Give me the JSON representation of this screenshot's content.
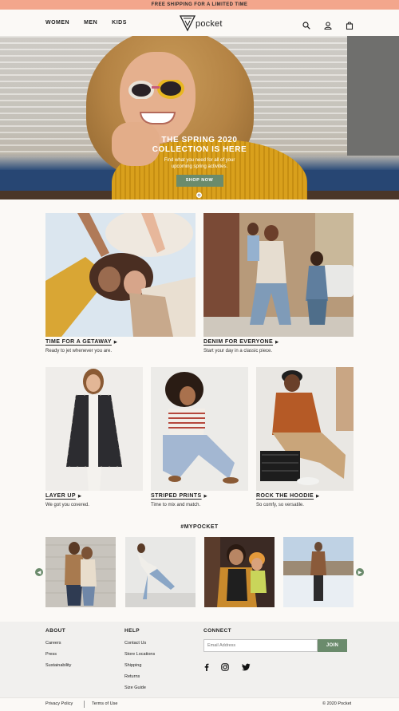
{
  "promo": {
    "text": "FREE SHIPPING FOR A LIMITED TIME"
  },
  "header": {
    "nav": [
      {
        "label": "WOMEN"
      },
      {
        "label": "MEN"
      },
      {
        "label": "KIDS"
      }
    ],
    "logo_text": "pocket",
    "icons": [
      "search-icon",
      "user-icon",
      "bag-icon"
    ]
  },
  "hero": {
    "title_line1": "THE SPRING 2020",
    "title_line2": "COLLECTION IS HERE",
    "subtitle_line1": "Find what you need for all of your",
    "subtitle_line2": "upcoming spring activities.",
    "button_label": "SHOP NOW"
  },
  "features": [
    {
      "title": "TIME FOR A GETAWAY",
      "subtitle": "Ready to jet whenever you are."
    },
    {
      "title": "DENIM FOR EVERYONE",
      "subtitle": "Start your day in a classic piece."
    }
  ],
  "products": [
    {
      "title": "LAYER UP",
      "subtitle": "We got you covered."
    },
    {
      "title": "STRIPED PRINTS",
      "subtitle": "Time to mix and match."
    },
    {
      "title": "ROCK THE HOODIE",
      "subtitle": "So comfy, so versatile."
    }
  ],
  "instagram": {
    "heading": "#MYPOCKET"
  },
  "footer": {
    "about": {
      "title": "ABOUT",
      "links": [
        "Careers",
        "Press",
        "Sustainability"
      ]
    },
    "help": {
      "title": "HELP",
      "links": [
        "Contact Us",
        "Store Locations",
        "Shipping",
        "Returns",
        "Size Guide"
      ]
    },
    "connect": {
      "title": "CONNECT",
      "email_placeholder": "Email Address",
      "join_label": "JOIN"
    },
    "social_icons": [
      "facebook-icon",
      "instagram-icon",
      "twitter-icon"
    ]
  },
  "legal": {
    "privacy": "Privacy Policy",
    "terms": "Terms of Use",
    "copyright": "© 2020 Pocket"
  },
  "colors": {
    "promo": "#f3a68c",
    "accent_green": "#6b8b6c",
    "footer_bg": "#f1f0ee"
  }
}
